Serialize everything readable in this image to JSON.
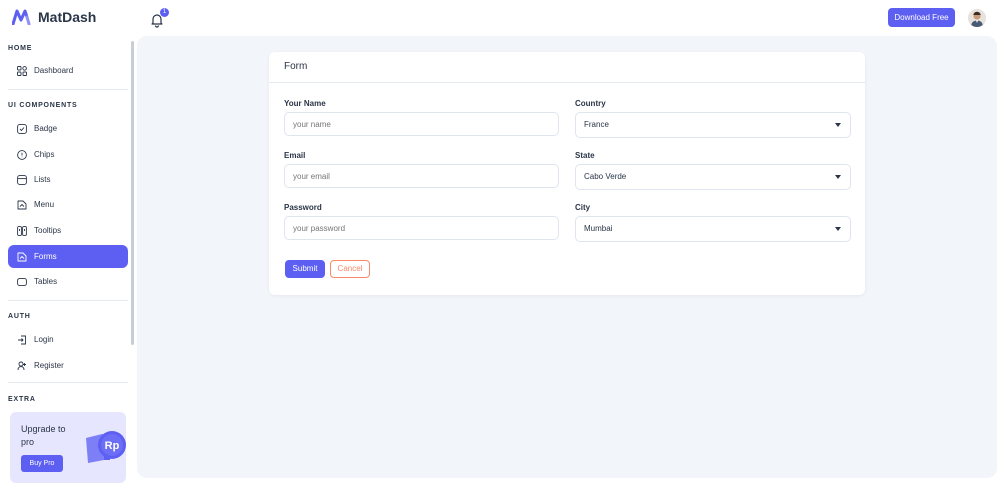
{
  "brand": {
    "name": "MatDash",
    "accent": "#5d5ff3"
  },
  "header": {
    "notification_count": "1",
    "download_label": "Download Free"
  },
  "sidebar": {
    "sections": [
      {
        "title": "HOME",
        "items": [
          {
            "label": "Dashboard",
            "icon": "dashboard-icon"
          }
        ]
      },
      {
        "title": "UI COMPONENTS",
        "items": [
          {
            "label": "Badge",
            "icon": "badge-icon"
          },
          {
            "label": "Chips",
            "icon": "chips-icon"
          },
          {
            "label": "Lists",
            "icon": "lists-icon"
          },
          {
            "label": "Menu",
            "icon": "menu-icon"
          },
          {
            "label": "Tooltips",
            "icon": "tooltips-icon"
          },
          {
            "label": "Forms",
            "icon": "forms-icon",
            "active": true
          },
          {
            "label": "Tables",
            "icon": "tables-icon"
          }
        ]
      },
      {
        "title": "AUTH",
        "items": [
          {
            "label": "Login",
            "icon": "login-icon"
          },
          {
            "label": "Register",
            "icon": "register-icon"
          }
        ]
      },
      {
        "title": "EXTRA",
        "items": []
      }
    ],
    "promo": {
      "title": "Upgrade to pro",
      "button": "Buy Pro",
      "badge": "Rp"
    }
  },
  "form": {
    "title": "Form",
    "name": {
      "label": "Your Name",
      "placeholder": "your name"
    },
    "email": {
      "label": "Email",
      "placeholder": "your email"
    },
    "password": {
      "label": "Password",
      "placeholder": "your password"
    },
    "country": {
      "label": "Country",
      "value": "France"
    },
    "state": {
      "label": "State",
      "value": "Cabo Verde"
    },
    "city": {
      "label": "City",
      "value": "Mumbai"
    },
    "submit": "Submit",
    "cancel": "Cancel"
  }
}
